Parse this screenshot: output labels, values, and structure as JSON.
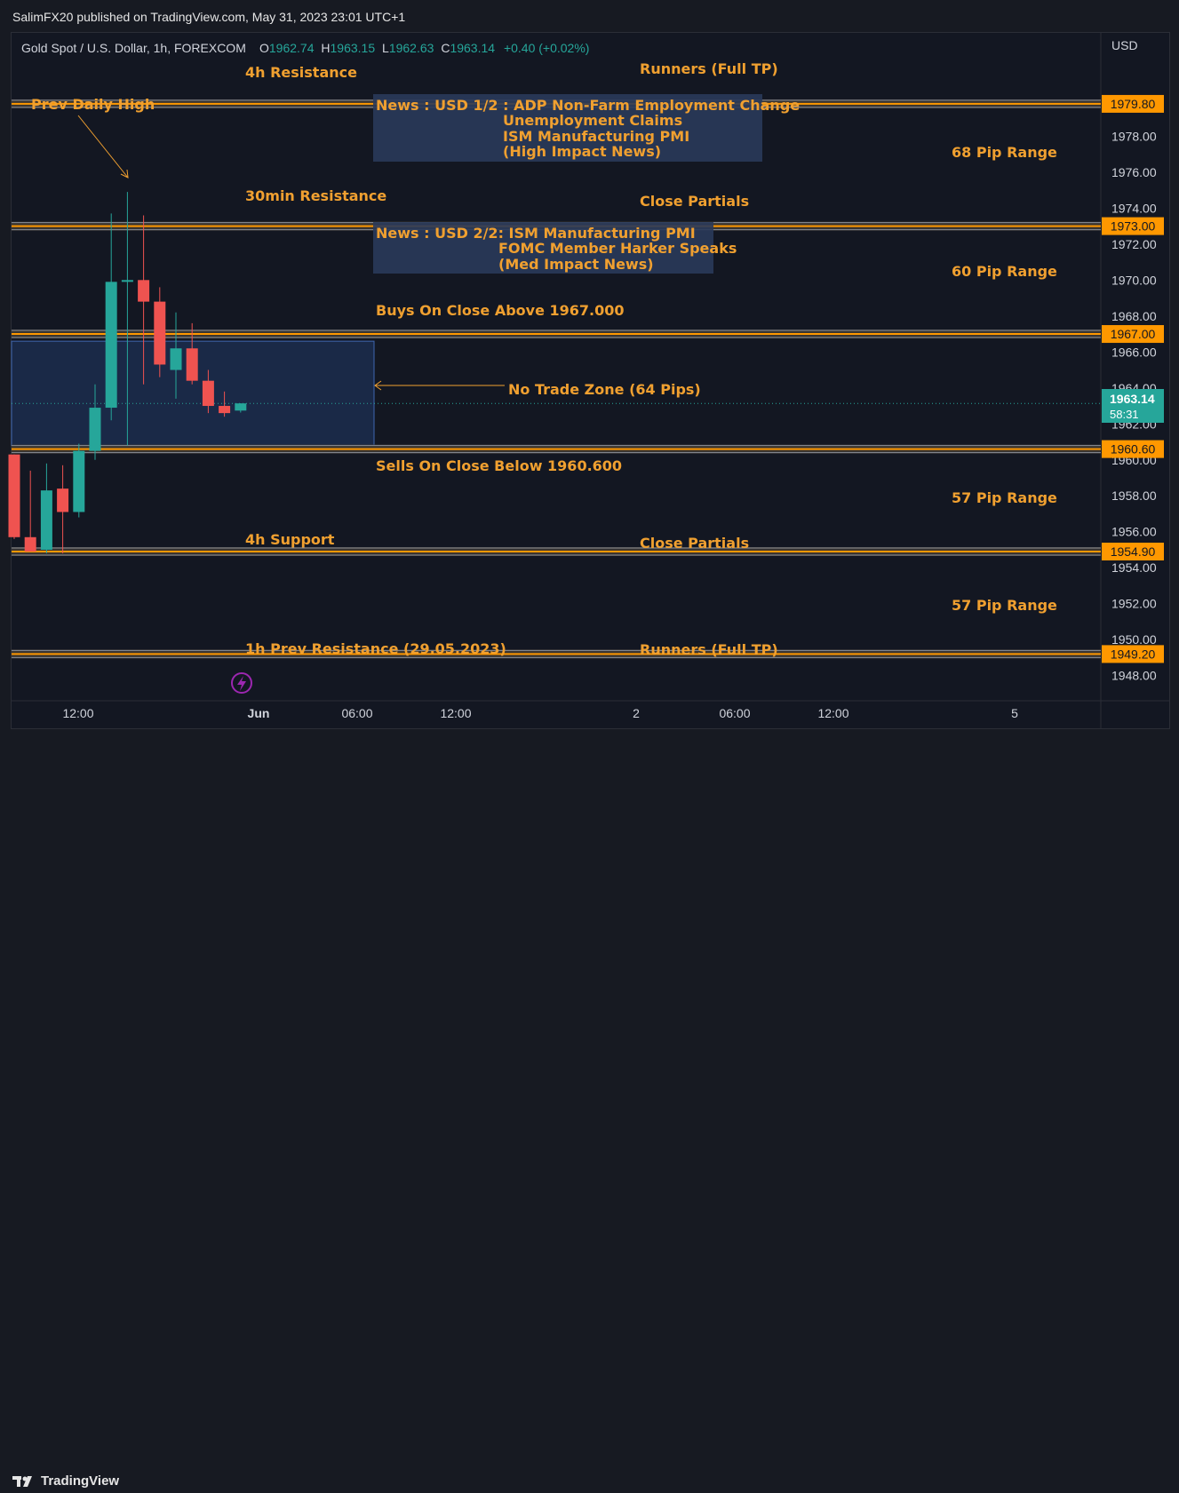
{
  "publisher": "SalimFX20 published on TradingView.com, May 31, 2023 23:01 UTC+1",
  "footer_brand": "TradingView",
  "colors": {
    "up": "#26a69a",
    "down": "#ef5350",
    "annotation": "#f0a030",
    "price_tag_bg": "#ff9800",
    "news_box": "#2a3a5a",
    "zone": "#1c2d4d"
  },
  "chart_data": {
    "type": "candlestick",
    "symbol_header": {
      "name": "Gold Spot / U.S. Dollar, 1h, FOREXCOM",
      "o_label": "O",
      "o": "1962.74",
      "h_label": "H",
      "h": "1963.15",
      "l_label": "L",
      "l": "1962.63",
      "c_label": "C",
      "c": "1963.14",
      "change": "+0.40 (+0.02%)"
    },
    "currency": "USD",
    "y_ticks": [
      "1978.00",
      "1976.00",
      "1974.00",
      "1972.00",
      "1970.00",
      "1968.00",
      "1966.00",
      "1964.00",
      "1962.00",
      "1960.00",
      "1958.00",
      "1956.00",
      "1954.00",
      "1952.00",
      "1950.00",
      "1948.00"
    ],
    "ylim": [
      1946.7,
      1983.6
    ],
    "x_ticks": [
      "12:00",
      "Jun",
      "06:00",
      "12:00",
      "2",
      "06:00",
      "12:00",
      "5"
    ],
    "last_price": "1963.14",
    "countdown": "58:31",
    "candles": [
      {
        "o": 1960.3,
        "h": 1960.3,
        "l": 1955.6,
        "c": 1955.7
      },
      {
        "o": 1955.7,
        "h": 1959.4,
        "l": 1954.9,
        "c": 1954.9
      },
      {
        "o": 1955.0,
        "h": 1959.8,
        "l": 1954.8,
        "c": 1958.3
      },
      {
        "o": 1958.4,
        "h": 1959.7,
        "l": 1954.8,
        "c": 1957.1
      },
      {
        "o": 1957.1,
        "h": 1960.9,
        "l": 1956.8,
        "c": 1960.5
      },
      {
        "o": 1960.5,
        "h": 1964.2,
        "l": 1960.0,
        "c": 1962.9
      },
      {
        "o": 1962.9,
        "h": 1973.7,
        "l": 1962.2,
        "c": 1969.9
      },
      {
        "o": 1969.9,
        "h": 1974.9,
        "l": 1960.8,
        "c": 1970.0
      },
      {
        "o": 1970.0,
        "h": 1973.6,
        "l": 1964.2,
        "c": 1968.8
      },
      {
        "o": 1968.8,
        "h": 1969.6,
        "l": 1964.6,
        "c": 1965.3
      },
      {
        "o": 1965.0,
        "h": 1968.2,
        "l": 1963.4,
        "c": 1966.2
      },
      {
        "o": 1966.2,
        "h": 1967.6,
        "l": 1964.2,
        "c": 1964.4
      },
      {
        "o": 1964.4,
        "h": 1965.0,
        "l": 1962.6,
        "c": 1963.0
      },
      {
        "o": 1963.0,
        "h": 1963.8,
        "l": 1962.4,
        "c": 1962.6
      },
      {
        "o": 1962.74,
        "h": 1963.15,
        "l": 1962.63,
        "c": 1963.14
      }
    ],
    "levels": [
      {
        "price": 1979.8,
        "tag": "1979.80"
      },
      {
        "price": 1973.0,
        "tag": "1973.00"
      },
      {
        "price": 1967.0,
        "tag": "1967.00"
      },
      {
        "price": 1960.6,
        "tag": "1960.60"
      },
      {
        "price": 1954.9,
        "tag": "1954.90"
      },
      {
        "price": 1949.2,
        "tag": "1949.20"
      }
    ],
    "zone": {
      "top": 1966.6,
      "bottom": 1960.8
    },
    "annotations": {
      "r4h": "4h Resistance",
      "runners_top": "Runners (Full TP)",
      "prev_daily_high": "Prev Daily High",
      "range_68": "68 Pip Range",
      "r30m": "30min Resistance",
      "close_partials_top": "Close Partials",
      "range_60": "60 Pip Range",
      "buys": "Buys On Close Above 1967.000",
      "no_trade": "No Trade Zone (64 Pips)",
      "sells": "Sells On Close Below 1960.600",
      "range_57a": "57 Pip Range",
      "s4h": "4h Support",
      "close_partials_bottom": "Close Partials",
      "range_57b": "57 Pip Range",
      "r1h_prev": "1h Prev Resistance (29.05.2023)",
      "runners_bottom": "Runners (Full TP)"
    },
    "news1": {
      "line1": "News : USD 1/2 : ADP Non-Farm Employment Change",
      "line2": "Unemployment Claims",
      "line3": "ISM Manufacturing PMI",
      "line4": "(High Impact News)"
    },
    "news2": {
      "line1": "News : USD 2/2: ISM Manufacturing PMI",
      "line2": "FOMC Member Harker Speaks",
      "line3": "(Med Impact News)"
    }
  }
}
